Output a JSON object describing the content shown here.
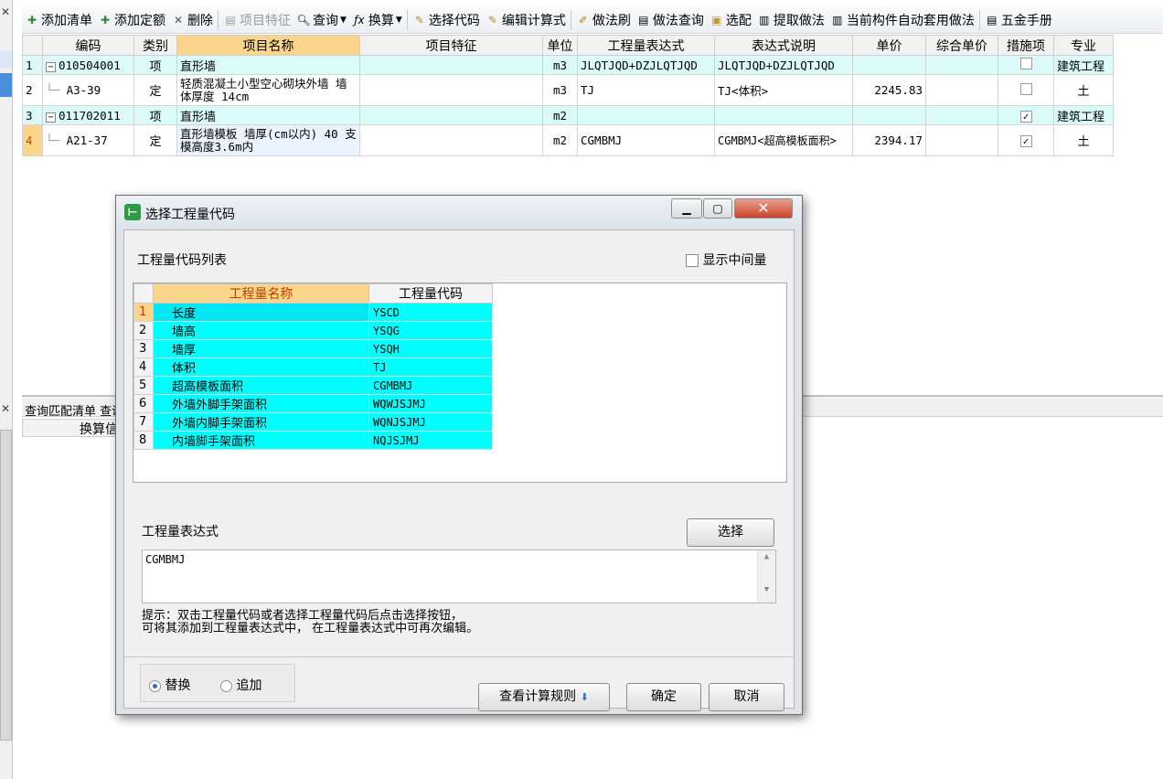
{
  "toolbar": {
    "items": [
      {
        "label": "添加清单",
        "icon": "add-list-icon",
        "enabled": true
      },
      {
        "label": "添加定额",
        "icon": "add-quota-icon",
        "enabled": true
      },
      {
        "label": "删除",
        "icon": "delete-icon",
        "enabled": true
      },
      {
        "label": "项目特征",
        "icon": "item-feature-icon",
        "enabled": false
      },
      {
        "label": "查询",
        "icon": "search-icon",
        "enabled": true
      },
      {
        "label": "换算",
        "icon": "fx-icon",
        "enabled": true
      },
      {
        "label": "选择代码",
        "icon": "select-code-icon",
        "enabled": true
      },
      {
        "label": "编辑计算式",
        "icon": "edit-formula-icon",
        "enabled": true
      },
      {
        "label": "做法刷",
        "icon": "method-brush-icon",
        "enabled": true
      },
      {
        "label": "做法查询",
        "icon": "method-search-icon",
        "enabled": true
      },
      {
        "label": "选配",
        "icon": "select-match-icon",
        "enabled": true
      },
      {
        "label": "提取做法",
        "icon": "extract-method-icon",
        "enabled": true
      },
      {
        "label": "当前构件自动套用做法",
        "icon": "auto-apply-icon",
        "enabled": true
      },
      {
        "label": "五金手册",
        "icon": "hardware-manual-icon",
        "enabled": true
      }
    ]
  },
  "grid": {
    "headers": [
      "编码",
      "类别",
      "项目名称",
      "项目特征",
      "单位",
      "工程量表达式",
      "表达式说明",
      "单价",
      "综合单价",
      "措施项",
      "专业"
    ],
    "rows": [
      {
        "num": "1",
        "code": "010504001",
        "type": "项",
        "name": "直形墙",
        "feature": "",
        "unit": "m3",
        "expr": "JLQTJQD+DZJLQTJQD",
        "desc": "JLQTJQD+DZJLQTJQD",
        "price": "",
        "total": "",
        "measure": false,
        "major": "建筑工程"
      },
      {
        "num": "2",
        "code": "A3-39",
        "type": "定",
        "name": "轻质混凝土小型空心砌块外墙 墙体厚度 14cm",
        "feature": "",
        "unit": "m3",
        "expr": "TJ",
        "desc": "TJ<体积>",
        "price": "2245.83",
        "total": "",
        "measure": false,
        "major": "土"
      },
      {
        "num": "3",
        "code": "011702011",
        "type": "项",
        "name": "直形墙",
        "feature": "",
        "unit": "m2",
        "expr": "",
        "desc": "",
        "price": "",
        "total": "",
        "measure": true,
        "major": "建筑工程"
      },
      {
        "num": "4",
        "code": "A21-37",
        "type": "定",
        "name": "直形墙模板 墙厚(cm以内) 40 支模高度3.6m内",
        "feature": "",
        "unit": "m2",
        "expr": "CGMBMJ",
        "desc": "CGMBMJ<超高模板面积>",
        "price": "2394.17",
        "total": "",
        "measure": true,
        "major": "土"
      }
    ]
  },
  "lower": {
    "tab_text": "查询匹配清单  查询",
    "col_header": "换算信"
  },
  "dialog": {
    "title": "选择工程量代码",
    "list_label": "工程量代码列表",
    "show_intermediate_label": "显示中间量",
    "table_headers": [
      "工程量名称",
      "工程量代码"
    ],
    "quantities": [
      {
        "num": "1",
        "name": "长度",
        "code": "YSCD"
      },
      {
        "num": "2",
        "name": "墙高",
        "code": "YSQG"
      },
      {
        "num": "3",
        "name": "墙厚",
        "code": "YSQH"
      },
      {
        "num": "4",
        "name": "体积",
        "code": "TJ"
      },
      {
        "num": "5",
        "name": "超高模板面积",
        "code": "CGMBMJ"
      },
      {
        "num": "6",
        "name": "外墙外脚手架面积",
        "code": "WQWJSJMJ"
      },
      {
        "num": "7",
        "name": "外墙内脚手架面积",
        "code": "WQNJSJMJ"
      },
      {
        "num": "8",
        "name": "内墙脚手架面积",
        "code": "NQJSJMJ"
      }
    ],
    "expr_label": "工程量表达式",
    "select_button": "选择",
    "expr_value": "CGMBMJ",
    "hint_line1": "提示：双击工程量代码或者选择工程量代码后点击选择按钮，",
    "hint_line2": "可将其添加到工程量表达式中， 在工程量表达式中可再次编辑。",
    "radio_replace": "替换",
    "radio_append": "追加",
    "rules_button": "查看计算规则",
    "ok_button": "确定",
    "cancel_button": "取消"
  }
}
